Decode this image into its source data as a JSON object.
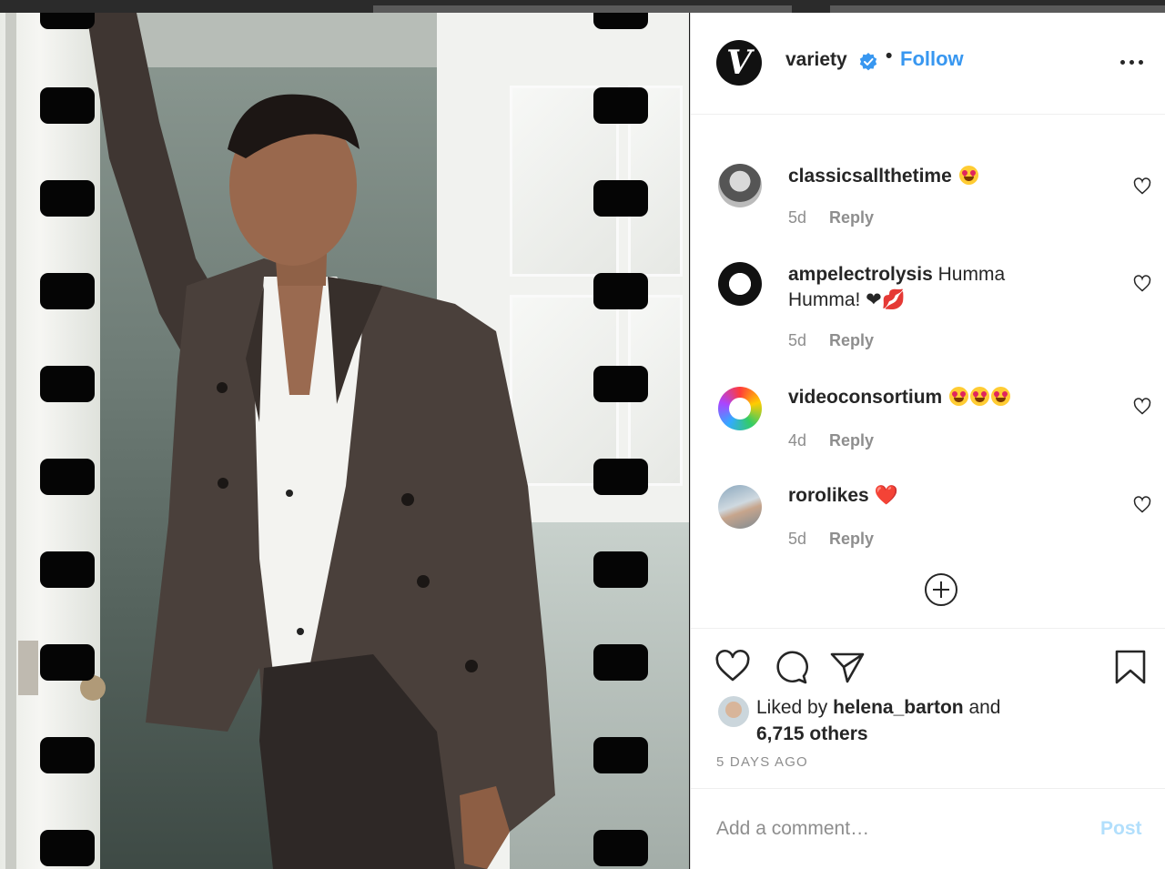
{
  "post": {
    "account": {
      "username": "variety",
      "logo_letter": "V",
      "verified": true,
      "separator": "•",
      "follow_label": "Follow"
    },
    "comments": [
      {
        "username": "classicsallthetime",
        "text": "",
        "emoji": [
          "smiling-face-heart-eyes"
        ],
        "time": "5d",
        "reply_label": "Reply"
      },
      {
        "username": "ampelectrolysis",
        "text": "Humma Humma! ❤💋",
        "emoji": [],
        "time": "5d",
        "reply_label": "Reply"
      },
      {
        "username": "videoconsortium",
        "text": "",
        "emoji": [
          "smiling-face-heart-eyes",
          "smiling-face-heart-eyes",
          "smiling-face-heart-eyes"
        ],
        "time": "4d",
        "reply_label": "Reply"
      },
      {
        "username": "rorolikes",
        "text": "❤️",
        "emoji": [],
        "time": "5d",
        "reply_label": "Reply"
      }
    ],
    "likes": {
      "prefix": "Liked by",
      "liked_by_user": "helena_barton",
      "conjunction": "and",
      "others": "6,715 others"
    },
    "posted_ago": "5 DAYS AGO",
    "comment_input": {
      "placeholder": "Add a comment…",
      "post_label": "Post"
    },
    "icons": [
      "heart-icon",
      "comment-icon",
      "share-icon",
      "bookmark-icon",
      "more-options-icon",
      "load-more-icon",
      "verified-badge-icon"
    ],
    "colors": {
      "link_blue": "#3897f0",
      "post_disabled": "#b2dffc",
      "meta_gray": "#8e8e8e",
      "text": "#262626"
    }
  }
}
